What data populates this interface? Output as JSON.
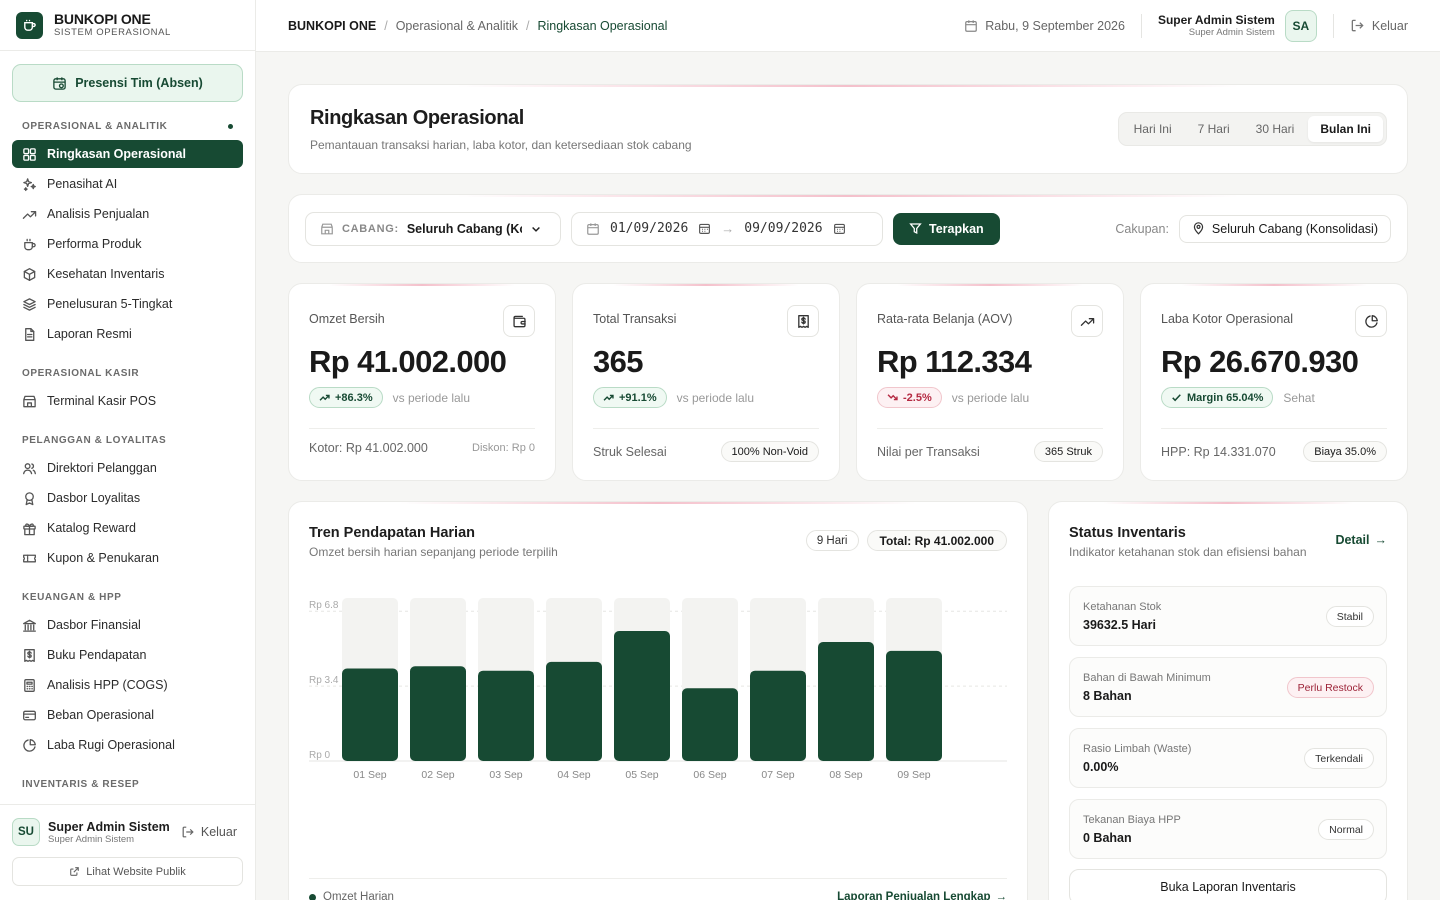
{
  "colors": {
    "accent": "#174a33",
    "accent_light": "#eaf6ee",
    "bar_track": "#f3f3f1",
    "negative": "#b52a42"
  },
  "sidebar": {
    "brand_name": "BUNKOPI ONE",
    "brand_sub": "SISTEM OPERASIONAL",
    "presensi_label": "Presensi Tim (Absen)",
    "sections": [
      {
        "title": "OPERASIONAL & ANALITIK",
        "items": [
          {
            "label": "Ringkasan Operasional",
            "icon": "grid-icon"
          },
          {
            "label": "Penasihat AI",
            "icon": "sparkle-icon"
          },
          {
            "label": "Analisis Penjualan",
            "icon": "trend-up-icon"
          },
          {
            "label": "Performa Produk",
            "icon": "coffee-cup-icon"
          },
          {
            "label": "Kesehatan Inventaris",
            "icon": "box-icon"
          },
          {
            "label": "Penelusuran 5-Tingkat",
            "icon": "layers-icon"
          },
          {
            "label": "Laporan Resmi",
            "icon": "document-icon"
          }
        ]
      },
      {
        "title": "OPERASIONAL KASIR",
        "items": [
          {
            "label": "Terminal Kasir POS",
            "icon": "store-icon"
          }
        ]
      },
      {
        "title": "PELANGGAN & LOYALITAS",
        "items": [
          {
            "label": "Direktori Pelanggan",
            "icon": "users-icon"
          },
          {
            "label": "Dasbor Loyalitas",
            "icon": "award-icon"
          },
          {
            "label": "Katalog Reward",
            "icon": "gift-icon"
          },
          {
            "label": "Kupon & Penukaran",
            "icon": "ticket-icon"
          }
        ]
      },
      {
        "title": "KEUANGAN & HPP",
        "items": [
          {
            "label": "Dasbor Finansial",
            "icon": "bank-icon"
          },
          {
            "label": "Buku Pendapatan",
            "icon": "receipt-dollar-icon"
          },
          {
            "label": "Analisis HPP (COGS)",
            "icon": "calculator-icon"
          },
          {
            "label": "Beban Operasional",
            "icon": "credit-card-icon"
          },
          {
            "label": "Laba Rugi Operasional",
            "icon": "pie-chart-icon"
          }
        ]
      },
      {
        "title": "INVENTARIS & RESEP",
        "items": []
      }
    ],
    "footer": {
      "user_initials": "SU",
      "user_name": "Super Admin Sistem",
      "user_role": "Super Admin Sistem",
      "logout_label": "Keluar",
      "public_link": "Lihat Website Publik"
    }
  },
  "topbar": {
    "breadcrumb": [
      "BUNKOPI ONE",
      "Operasional & Analitik",
      "Ringkasan Operasional"
    ],
    "date": "Rabu, 9 September 2026",
    "user_name": "Super Admin Sistem",
    "user_role": "Super Admin Sistem",
    "user_initials": "SA",
    "logout_label": "Keluar"
  },
  "header": {
    "title": "Ringkasan Operasional",
    "subtitle": "Pemantauan transaksi harian, laba kotor, dan ketersediaan stok cabang",
    "periods": [
      "Hari Ini",
      "7 Hari",
      "30 Hari",
      "Bulan Ini"
    ],
    "active_period": "Bulan Ini"
  },
  "filters": {
    "branch_label": "CABANG:",
    "branch_value": "Seluruh Cabang (Konsolidasi)",
    "date_from": "01/09/2026",
    "date_to": "09/09/2026",
    "apply_label": "Terapkan",
    "scope_label": "Cakupan:",
    "scope_value": "Seluruh Cabang (Konsolidasi)"
  },
  "kpis": [
    {
      "label": "Omzet Bersih",
      "value": "Rp 41.002.000",
      "change": "+86.3%",
      "direction": "up",
      "note": "vs periode lalu",
      "footer_left": "Kotor: Rp 41.002.000",
      "footer_right": "Diskon: Rp 0",
      "icon": "wallet-icon"
    },
    {
      "label": "Total Transaksi",
      "value": "365",
      "change": "+91.1%",
      "direction": "up",
      "note": "vs periode lalu",
      "footer_left": "Struk Selesai",
      "footer_right": "100% Non-Void",
      "icon": "receipt-icon"
    },
    {
      "label": "Rata-rata Belanja (AOV)",
      "value": "Rp 112.334",
      "change": "-2.5%",
      "direction": "down",
      "note": "vs periode lalu",
      "footer_left": "Nilai per Transaksi",
      "footer_right": "365 Struk",
      "icon": "trend-up-icon"
    },
    {
      "label": "Laba Kotor Operasional",
      "value": "Rp 26.670.930",
      "change": "Margin 65.04%",
      "direction": "check",
      "note": "Sehat",
      "footer_left": "HPP: Rp 14.331.070",
      "footer_right": "Biaya 35.0%",
      "icon": "pie-chart-icon"
    }
  ],
  "trend": {
    "title": "Tren Pendapatan Harian",
    "subtitle": "Omzet bersih harian sepanjang periode terpilih",
    "days_badge": "9 Hari",
    "total_badge": "Total: Rp 41.002.000",
    "legend": "Omzet Harian",
    "full_report_link": "Laporan Penjualan Lengkap"
  },
  "chart_data": {
    "type": "bar",
    "categories": [
      "01 Sep",
      "02 Sep",
      "03 Sep",
      "04 Sep",
      "05 Sep",
      "06 Sep",
      "07 Sep",
      "08 Sep",
      "09 Sep"
    ],
    "values": [
      4.2,
      4.3,
      4.1,
      4.5,
      5.9,
      3.3,
      4.1,
      5.4,
      5.0
    ],
    "yticks": [
      "Rp 0",
      "Rp 3.4",
      "Rp 6.8"
    ],
    "ylim": [
      0,
      7.4
    ],
    "grid": true
  },
  "inventory": {
    "title": "Status Inventaris",
    "subtitle": "Indikator ketahanan stok dan efisiensi bahan",
    "detail_label": "Detail",
    "rows": [
      {
        "label": "Ketahanan Stok",
        "value": "39632.5 Hari",
        "status": "Stabil",
        "tone": "neutral"
      },
      {
        "label": "Bahan di Bawah Minimum",
        "value": "8 Bahan",
        "status": "Perlu Restock",
        "tone": "warn"
      },
      {
        "label": "Rasio Limbah (Waste)",
        "value": "0.00%",
        "status": "Terkendali",
        "tone": "neutral"
      },
      {
        "label": "Tekanan Biaya HPP",
        "value": "0 Bahan",
        "status": "Normal",
        "tone": "neutral"
      }
    ],
    "open_report": "Buka Laporan Inventaris"
  }
}
